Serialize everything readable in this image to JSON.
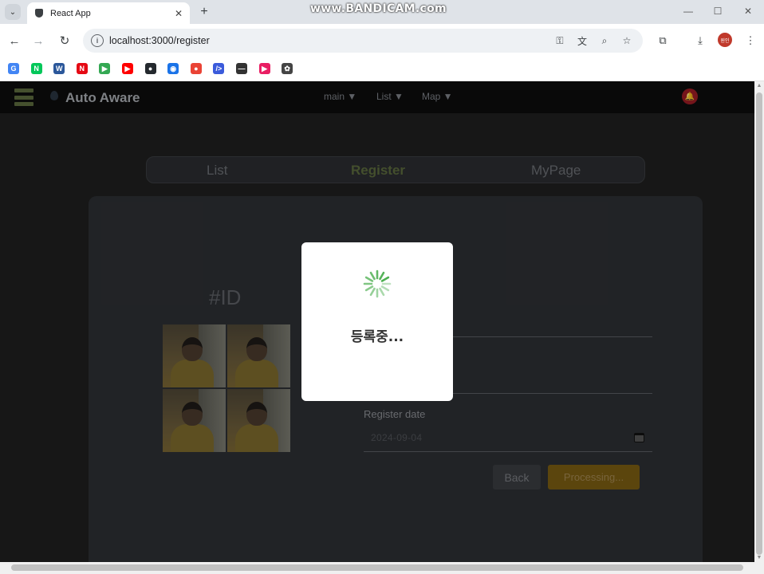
{
  "browser": {
    "tab_title": "React App",
    "watermark": "www.BANDICAM.com",
    "url": "localhost:3000/register",
    "avatar_text": "원인",
    "bookmarks": [
      {
        "icon": "google-icon",
        "glyph": "G",
        "color": "#4285f4"
      },
      {
        "icon": "naver-icon",
        "glyph": "N",
        "color": "#03c75a"
      },
      {
        "icon": "word-icon",
        "glyph": "W",
        "color": "#2b579a"
      },
      {
        "icon": "netflix-icon",
        "glyph": "N",
        "color": "#e50914"
      },
      {
        "icon": "play-store-icon",
        "glyph": "▶",
        "color": "#34a853"
      },
      {
        "icon": "youtube-icon",
        "glyph": "▶",
        "color": "#ff0000"
      },
      {
        "icon": "github-icon",
        "glyph": "●",
        "color": "#24292e"
      },
      {
        "icon": "chrome-icon",
        "glyph": "◉",
        "color": "#1a73e8"
      },
      {
        "icon": "app-icon",
        "glyph": "●",
        "color": "#ea4335"
      },
      {
        "icon": "code-icon",
        "glyph": "/>",
        "color": "#3b5bdb"
      },
      {
        "icon": "dash-icon",
        "glyph": "—",
        "color": "#333333"
      },
      {
        "icon": "cast-icon",
        "glyph": "▶",
        "color": "#e91e63"
      },
      {
        "icon": "openai-icon",
        "glyph": "✿",
        "color": "#444444"
      }
    ]
  },
  "app": {
    "brand": "Auto Aware",
    "menu": [
      {
        "label": "main ▼"
      },
      {
        "label": "List ▼"
      },
      {
        "label": "Map ▼"
      }
    ],
    "tabs": [
      {
        "label": "List"
      },
      {
        "label": "Register"
      },
      {
        "label": "MyPage"
      }
    ],
    "active_tab": "Register",
    "id_title": "#ID",
    "register_date_label": "Register date",
    "register_date_value": "2024-09-04",
    "back_label": "Back",
    "processing_label": "Processing...",
    "modal_text": "등록중..."
  },
  "colors": {
    "accent_green": "#5b6a3c",
    "processing_button": "#7a5c12",
    "spinner": "#4caf50"
  }
}
